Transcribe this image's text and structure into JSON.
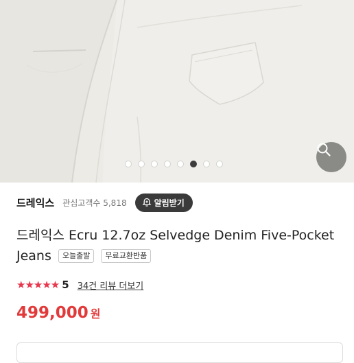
{
  "gallery": {
    "dots_total": 8,
    "active_index": 5,
    "zoom_icon": "search-icon"
  },
  "brand": {
    "name": "드레익스",
    "interest_label": "관심고객수",
    "interest_count": "5,818",
    "alert_label": "알림받기",
    "alert_icon": "bell-plus-icon"
  },
  "product": {
    "title": "드레익스 Ecru 12.7oz Selvedge Denim Five-Pocket Jeans",
    "badges": [
      "오늘출발",
      "무료교환반품"
    ]
  },
  "rating": {
    "stars": "★★★★★",
    "score": "5",
    "review_link": "34건 리뷰 더보기",
    "star_color": "#e8384f"
  },
  "price": {
    "amount": "499,000",
    "currency": "원",
    "color": "#e23a3a"
  }
}
